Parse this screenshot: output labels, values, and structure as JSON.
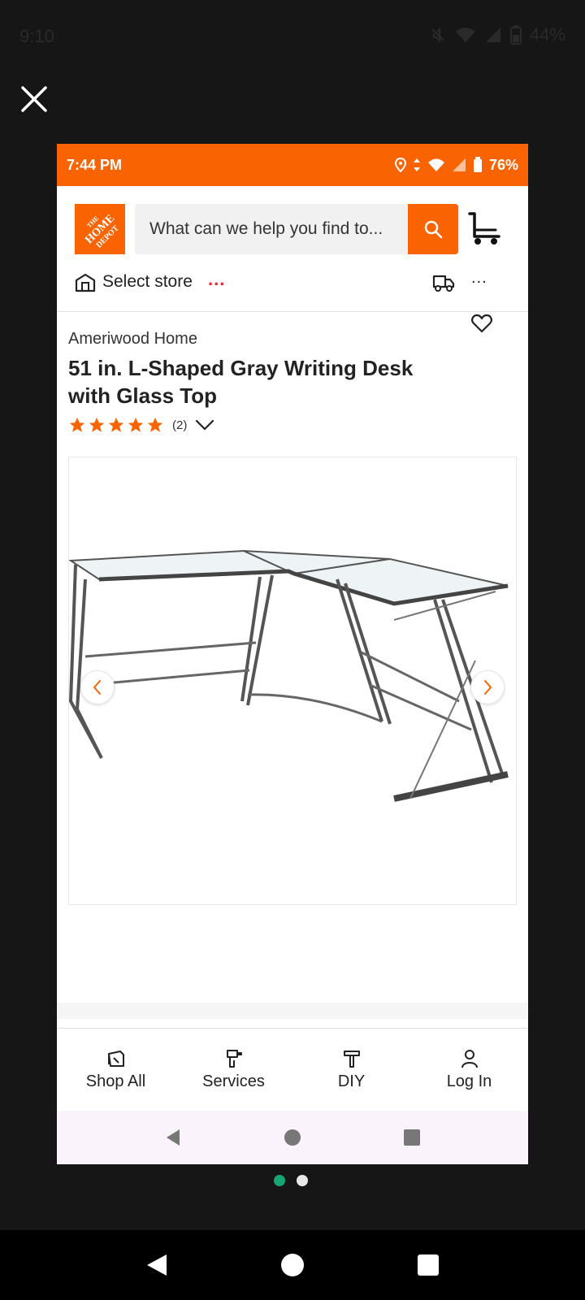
{
  "outer_status": {
    "time": "9:10",
    "battery": "44%"
  },
  "inner_status": {
    "time": "7:44 PM",
    "battery": "76%"
  },
  "header": {
    "search_placeholder": "What can we help you find to...",
    "logo_text": "THE HOME DEPOT"
  },
  "store": {
    "label": "Select store",
    "dots": "...",
    "more": "..."
  },
  "product": {
    "brand": "Ameriwood Home",
    "title": "51 in. L-Shaped Gray Writing Desk with Glass Top",
    "rating_stars": 5,
    "review_count": "(2)"
  },
  "gallery": {
    "current_image": 1,
    "image_count": 2
  },
  "bottom_nav": [
    {
      "label": "Shop All",
      "icon": "shop-all-icon"
    },
    {
      "label": "Services",
      "icon": "services-icon"
    },
    {
      "label": "DIY",
      "icon": "diy-icon"
    },
    {
      "label": "Log In",
      "icon": "user-icon"
    }
  ],
  "colors": {
    "brand_orange": "#f96302",
    "dot_active": "#17a673",
    "dot_inactive": "#e8e8e8"
  }
}
